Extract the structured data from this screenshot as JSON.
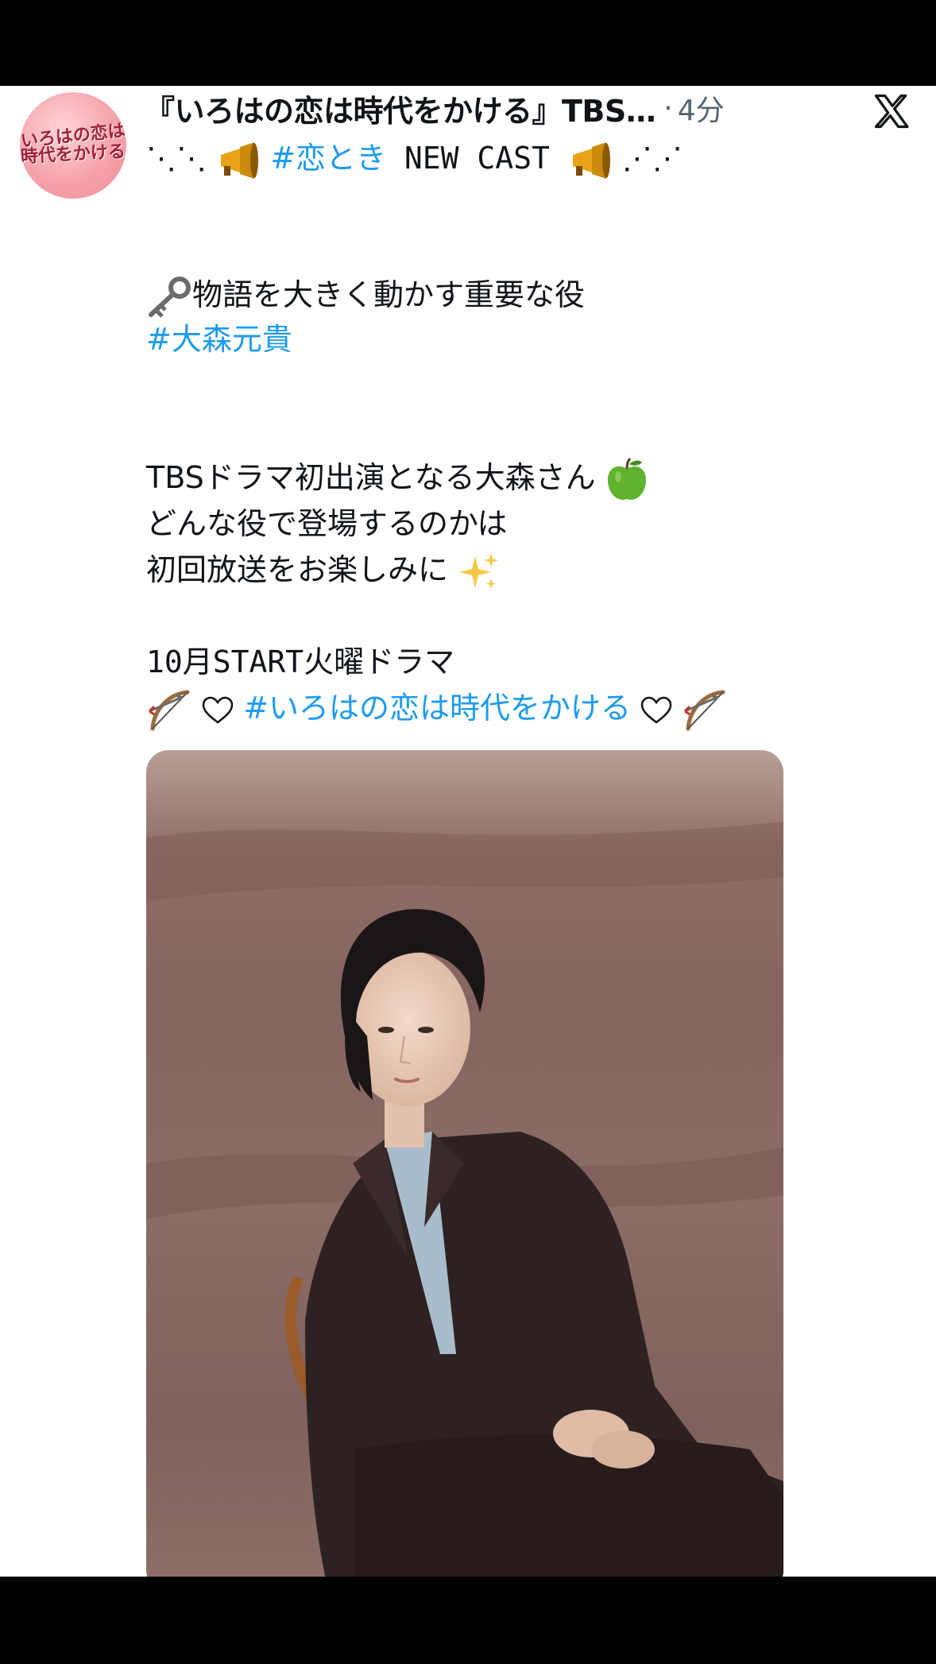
{
  "tweet": {
    "avatar": {
      "logo_line1": "いろはの恋は",
      "logo_line2": "時代をかける"
    },
    "author": {
      "display_name": "『いろはの恋は時代をかける』TBS…",
      "separator": "·",
      "time": "4分"
    },
    "header_line": {
      "dots_left": "⋱⋱",
      "hashtag": "#恋とき",
      "text": " NEW CAST ",
      "dots_right": "⋰⋰"
    },
    "role_line": "物語を大きく動かす重要な役",
    "role_hashtag": "#大森元貴",
    "body_line1": "TBSドラマ初出演となる大森さん",
    "body_line2": "どんな役で登場するのかは",
    "body_line3": "初回放送をお楽しみに",
    "schedule_line": "10月START火曜ドラマ",
    "title_hashtag": "#いろはの恋は時代をかける",
    "icons": {
      "megaphone": "megaphone-icon",
      "key": "key-icon",
      "apple": "green-apple-icon",
      "sparkles": "sparkles-icon",
      "bow": "bow-and-arrow-icon",
      "heart": "white-heart-icon",
      "x": "x-logo-icon"
    },
    "colors": {
      "link": "#1d9bf0",
      "text": "#0f1419",
      "secondary": "#536471",
      "photo_bg": "#8a6a64"
    }
  }
}
